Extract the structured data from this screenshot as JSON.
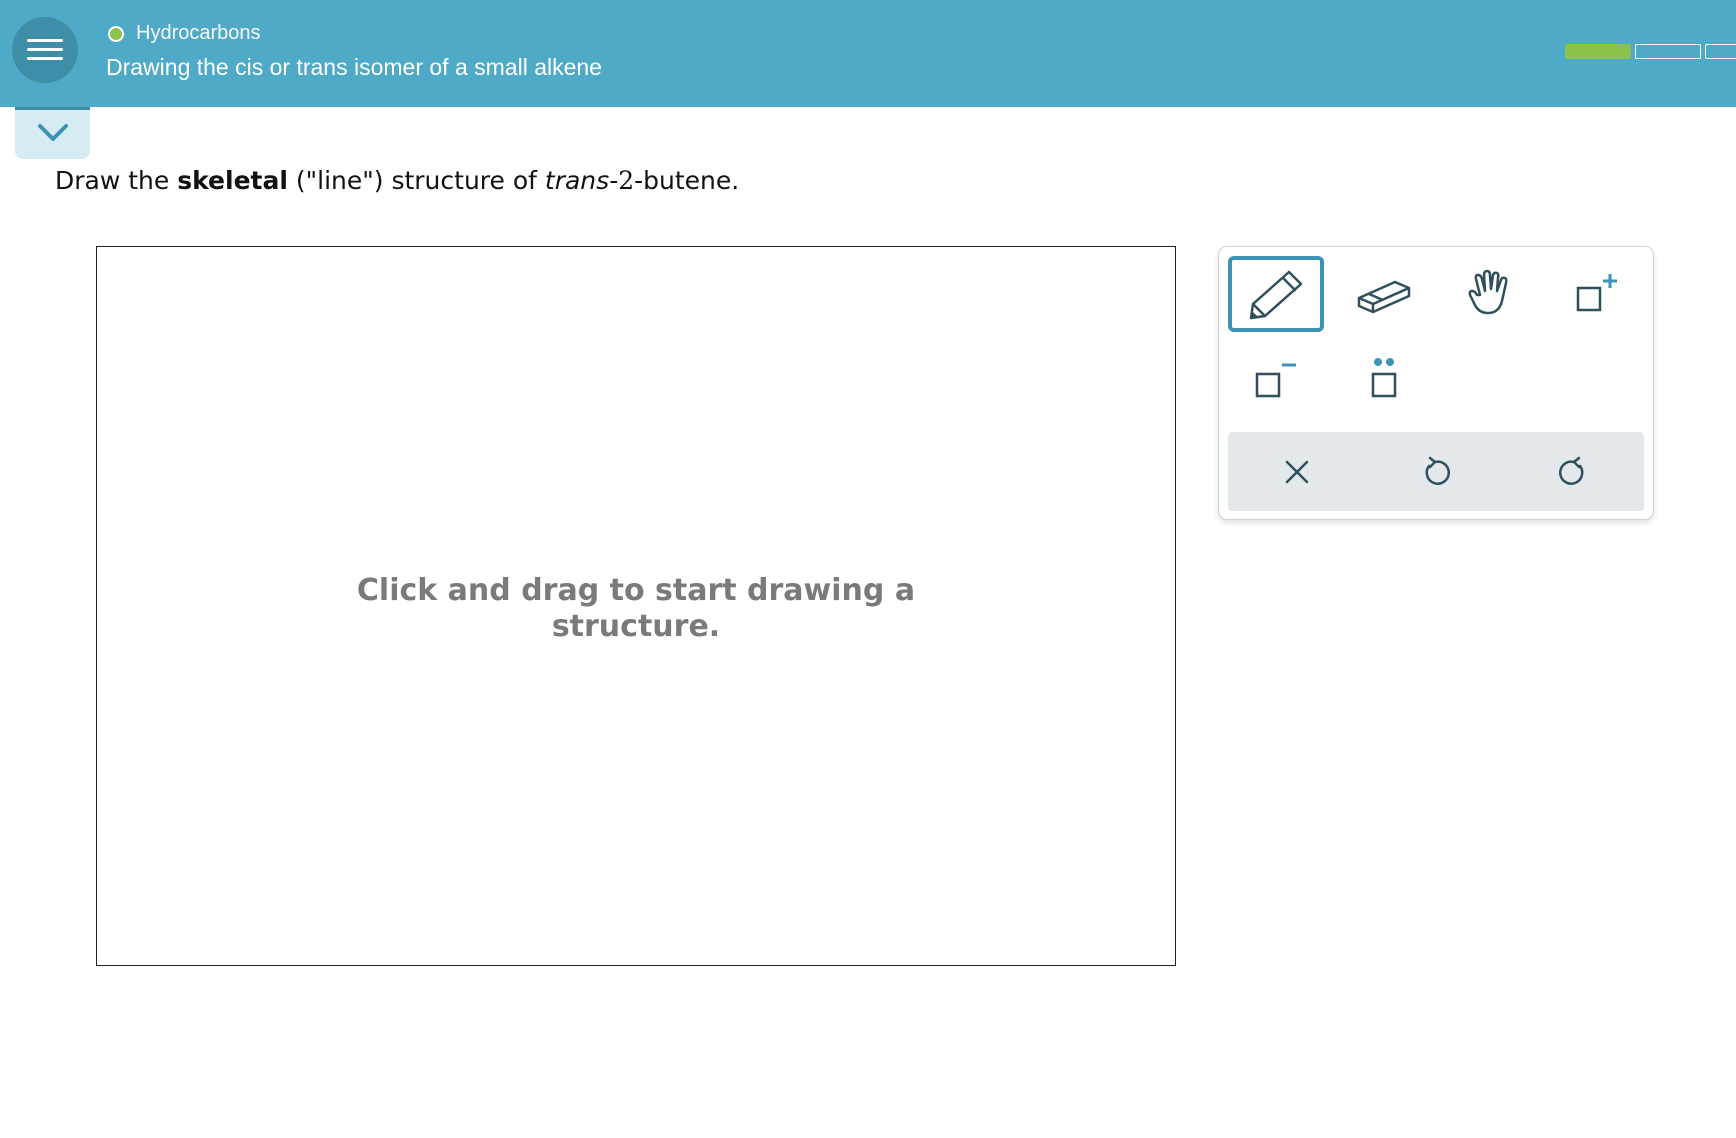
{
  "header": {
    "topic": "Hydrocarbons",
    "title": "Drawing the cis or trans isomer of a small alkene",
    "status_color": "#8bc34a",
    "progress": {
      "segments_total": 3,
      "segments_complete": 1
    }
  },
  "question": {
    "prefix": "Draw the ",
    "bold": "skeletal",
    "middle": " (\"line\") structure of ",
    "italic": "trans",
    "dash1": "-",
    "number": "2",
    "suffix": "-butene."
  },
  "canvas": {
    "hint": "Click and drag to start drawing a structure."
  },
  "toolbox": {
    "tools": [
      {
        "icon": "pencil-icon",
        "active": true
      },
      {
        "icon": "eraser-icon",
        "active": false
      },
      {
        "icon": "hand-icon",
        "active": false
      },
      {
        "icon": "add-charge-positive-icon",
        "active": false
      },
      {
        "icon": "add-charge-negative-icon",
        "active": false
      },
      {
        "icon": "lone-pair-icon",
        "active": false
      }
    ],
    "actions": [
      "clear-icon",
      "undo-icon",
      "redo-icon"
    ],
    "accent_color": "#3e93b4",
    "icon_color": "#2f4f5c"
  },
  "colors": {
    "header_bg": "#4eaac7",
    "menu_bg": "#3e8ea7",
    "progress_done": "#8bc34a"
  }
}
